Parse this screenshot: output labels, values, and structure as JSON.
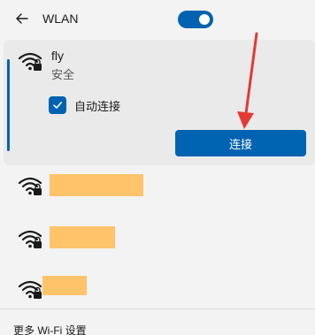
{
  "header": {
    "title": "WLAN",
    "toggle_on": true
  },
  "active_network": {
    "name": "fly",
    "status": "安全",
    "auto_connect_label": "自动连接",
    "auto_connect_checked": true,
    "connect_label": "连接"
  },
  "other_networks": [
    {
      "name_redacted": true
    },
    {
      "name_redacted": true
    },
    {
      "name_redacted": true
    }
  ],
  "footer": {
    "more_settings_label": "更多 Wi-Fi 设置"
  },
  "colors": {
    "accent": "#0063b1",
    "redaction": "#ffc36a",
    "annotation": "#e53935"
  },
  "icons": {
    "back": "back-arrow-icon",
    "wifi": "wifi-secured-icon",
    "check": "check-icon"
  }
}
